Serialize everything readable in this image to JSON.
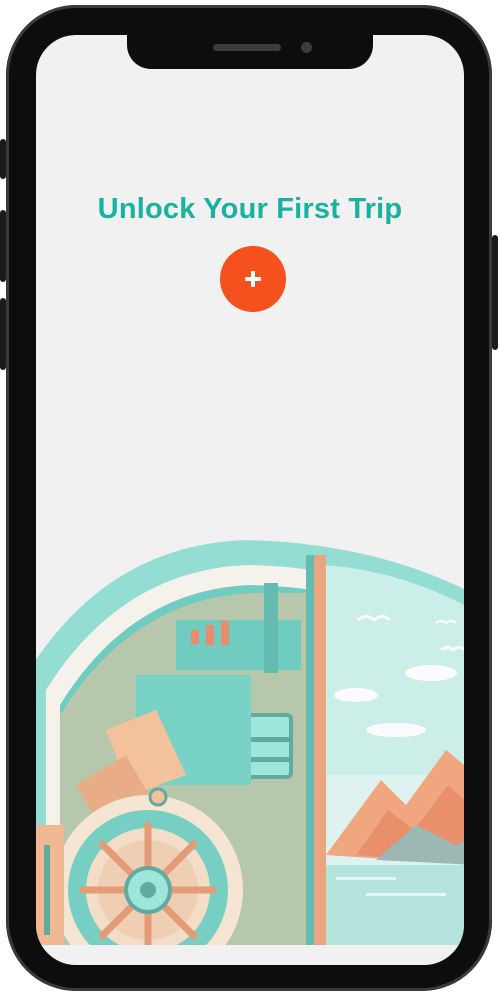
{
  "screen": {
    "title": "Unlock Your First Trip",
    "add_button": {
      "icon": "plus-icon",
      "color": "#f4511e"
    },
    "title_color": "#17b2a1",
    "background_color": "#f1f1f1"
  },
  "illustration": {
    "subject": "vault-door-icon",
    "scene": "mountain-landscape"
  }
}
